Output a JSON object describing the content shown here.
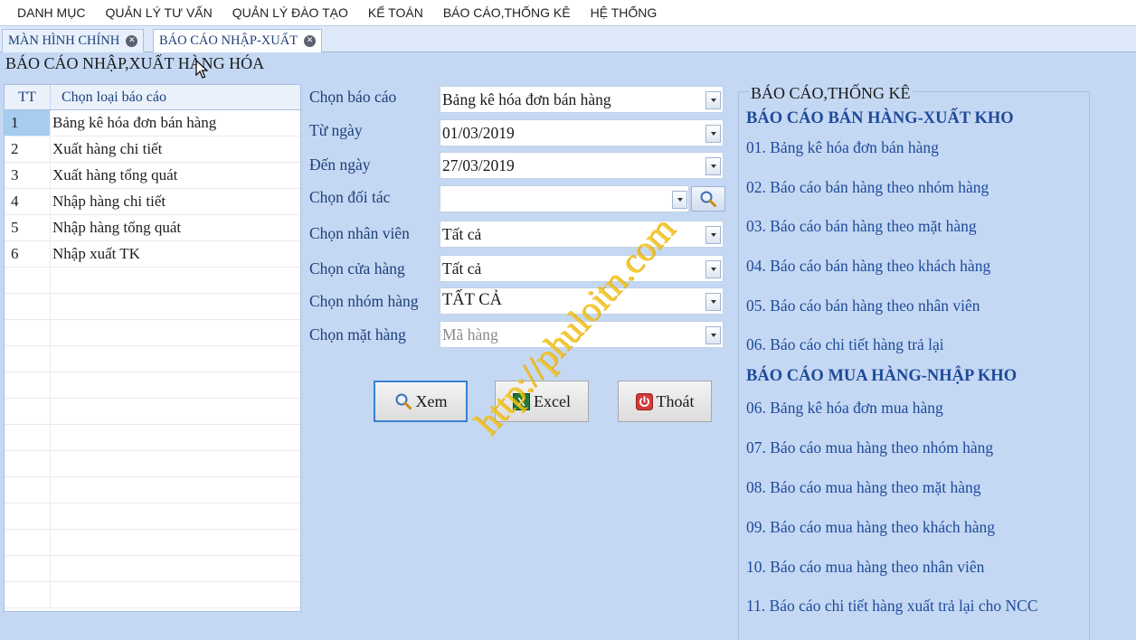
{
  "menu": [
    "DANH MỤC",
    "QUẢN LÝ TƯ VẤN",
    "QUẢN LÝ ĐÀO TẠO",
    "KẾ TOÁN",
    "BÁO CÁO,THỐNG KÊ",
    "HỆ THỐNG"
  ],
  "tabs": [
    {
      "label": "MÀN HÌNH CHÍNH",
      "active": false
    },
    {
      "label": "BÁO CÁO NHẬP-XUẤT",
      "active": true
    }
  ],
  "page_title": "BÁO CÁO NHẬP,XUẤT HÀNG HÓA",
  "grid": {
    "col_tt": "TT",
    "col_name": "Chọn loại báo cáo",
    "rows": [
      {
        "tt": "1",
        "name": "Bảng kê hóa đơn bán hàng"
      },
      {
        "tt": "2",
        "name": "Xuất hàng chi tiết"
      },
      {
        "tt": "3",
        "name": "Xuất hàng tổng quát"
      },
      {
        "tt": "4",
        "name": "Nhập hàng chi tiết"
      },
      {
        "tt": "5",
        "name": "Nhập hàng tổng quát"
      },
      {
        "tt": "6",
        "name": "Nhập xuất TK"
      }
    ],
    "selected_row": 0
  },
  "form": {
    "report": {
      "label": "Chọn báo cáo",
      "value": "Bảng kê hóa đơn bán hàng"
    },
    "from_date": {
      "label": "Từ ngày",
      "value": "01/03/2019"
    },
    "to_date": {
      "label": "Đến ngày",
      "value": "27/03/2019"
    },
    "partner": {
      "label": "Chọn đối tác",
      "value": ""
    },
    "employee": {
      "label": "Chọn nhân viên",
      "value": "Tất cả"
    },
    "store": {
      "label": "Chọn cửa hàng",
      "value": "Tất cả"
    },
    "group": {
      "label": "Chọn nhóm hàng",
      "value": "TẤT CẢ"
    },
    "item": {
      "label": "Chọn mặt hàng",
      "placeholder": "Mã hàng"
    }
  },
  "buttons": {
    "view": "Xem",
    "excel": "Excel",
    "exit": "Thoát"
  },
  "watermark": "http://phuloitn.com",
  "report_panel": {
    "title": "BÁO CÁO,THỐNG KÊ",
    "sales_section": "BÁO CÁO BÁN HÀNG-XUẤT KHO",
    "sales_links": [
      "01. Bảng kê hóa đơn bán hàng",
      "02. Báo cáo bán hàng theo nhóm hàng",
      "03. Báo cáo bán hàng theo mặt hàng",
      "04. Báo cáo bán hàng theo khách hàng",
      "05. Báo cáo bán hàng theo nhân viên",
      "06. Báo cáo chi tiết hàng trả lại"
    ],
    "purchase_section": "BÁO CÁO MUA HÀNG-NHẬP KHO",
    "purchase_links": [
      "06. Bảng kê hóa đơn mua hàng",
      "07. Báo cáo mua hàng theo nhóm hàng",
      "08. Báo cáo mua hàng theo mặt hàng",
      "09. Báo cáo mua hàng theo khách hàng",
      "10. Báo cáo mua hàng theo nhân viên",
      "11. Báo cáo chi tiết hàng xuất trả lại cho NCC"
    ]
  }
}
